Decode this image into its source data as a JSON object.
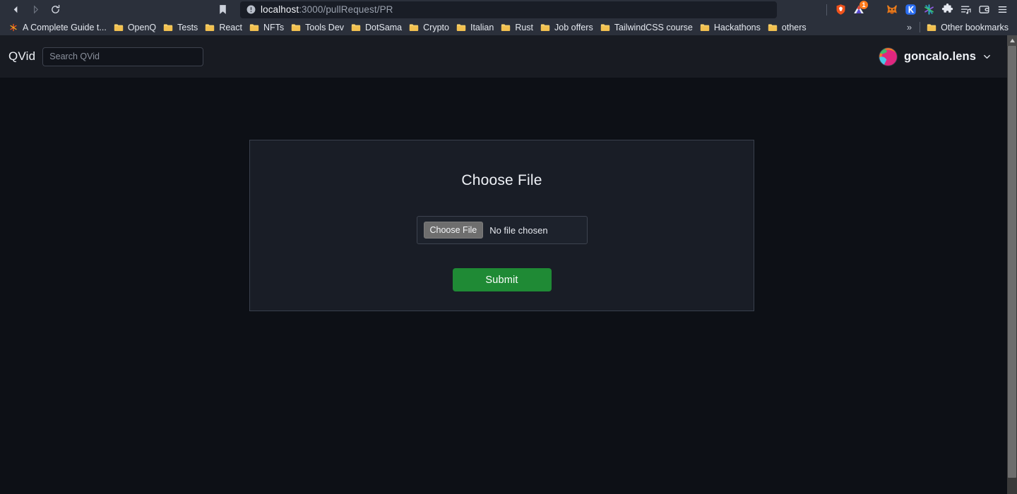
{
  "browser": {
    "nav": {
      "back_icon": "back-arrow-icon",
      "forward_icon": "forward-arrow-icon",
      "reload_icon": "reload-icon",
      "bookmark_icon": "bookmark-icon"
    },
    "omnibox": {
      "site_info_icon": "info-circle-icon",
      "url_host": "localhost",
      "url_path": ":3000/pullRequest/PR",
      "full_url": "localhost:3000/pullRequest/PR"
    },
    "toolbar_icons": [
      {
        "name": "brave-shield-icon",
        "badge": ""
      },
      {
        "name": "triangle-alert-icon",
        "badge": "1"
      },
      {
        "name": "metamask-fox-icon",
        "badge": ""
      },
      {
        "name": "keplr-k-icon",
        "badge": ""
      },
      {
        "name": "asterisk-icon",
        "badge": ""
      },
      {
        "name": "puzzle-extensions-icon",
        "badge": ""
      },
      {
        "name": "playlist-icon",
        "badge": ""
      },
      {
        "name": "wallet-icon",
        "badge": ""
      },
      {
        "name": "hamburger-menu-icon",
        "badge": ""
      }
    ],
    "bookmarks": [
      {
        "label": "A Complete Guide t...",
        "icon": "asterisk-icon"
      },
      {
        "label": "OpenQ",
        "icon": "folder-icon"
      },
      {
        "label": "Tests",
        "icon": "folder-icon"
      },
      {
        "label": "React",
        "icon": "folder-icon"
      },
      {
        "label": "NFTs",
        "icon": "folder-icon"
      },
      {
        "label": "Tools Dev",
        "icon": "folder-icon"
      },
      {
        "label": "DotSama",
        "icon": "folder-icon"
      },
      {
        "label": "Crypto",
        "icon": "folder-icon"
      },
      {
        "label": "Italian",
        "icon": "folder-icon"
      },
      {
        "label": "Rust",
        "icon": "folder-icon"
      },
      {
        "label": "Job offers",
        "icon": "folder-icon"
      },
      {
        "label": "TailwindCSS course",
        "icon": "folder-icon"
      },
      {
        "label": "Hackathons",
        "icon": "folder-icon"
      },
      {
        "label": "others",
        "icon": "folder-icon"
      }
    ],
    "bookmarks_overflow_label": "»",
    "other_bookmarks": {
      "label": "Other bookmarks",
      "icon": "folder-icon"
    }
  },
  "app": {
    "logo": "QVid",
    "search": {
      "value": "",
      "placeholder": "Search QVid"
    },
    "user": {
      "name": "goncalo.lens",
      "chevron_icon": "chevron-down-icon",
      "avatar_icon": "avatar"
    },
    "card": {
      "title": "Choose File",
      "file_input": {
        "button_label": "Choose File",
        "status_text": "No file chosen"
      },
      "submit_label": "Submit"
    }
  },
  "colors": {
    "browser_chrome": "#2b303b",
    "page_background": "#0d1016",
    "app_header": "#181b22",
    "card_background": "#191d26",
    "card_border": "#39404d",
    "submit_green": "#1f8a35",
    "choose_file_gray": "#6e6e6e",
    "badge_orange": "#ff7a1a"
  },
  "scrollbar": {
    "up_arrow_icon": "scroll-up-arrow-icon",
    "position": "top"
  }
}
